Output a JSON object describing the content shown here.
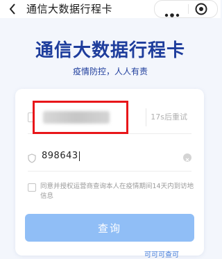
{
  "navbar": {
    "title": "通信大数据行程卡",
    "icons": [
      "back-icon",
      "more-icon",
      "close-icon"
    ]
  },
  "hero": {
    "title": "通信大数据行程卡",
    "subtitle": "疫情防控，人人有责"
  },
  "form": {
    "resend_label": "17s后重试",
    "code_value": "898643",
    "consent_text": "同意并授权运营商查询本人在疫情期间14天内到访地信息",
    "query_label": "查询",
    "bottom_link": "可可可查可"
  },
  "colors": {
    "brand": "#1e3d9c",
    "button": "#90bef6",
    "highlight": "#e8161a",
    "link": "#3f78d8"
  }
}
